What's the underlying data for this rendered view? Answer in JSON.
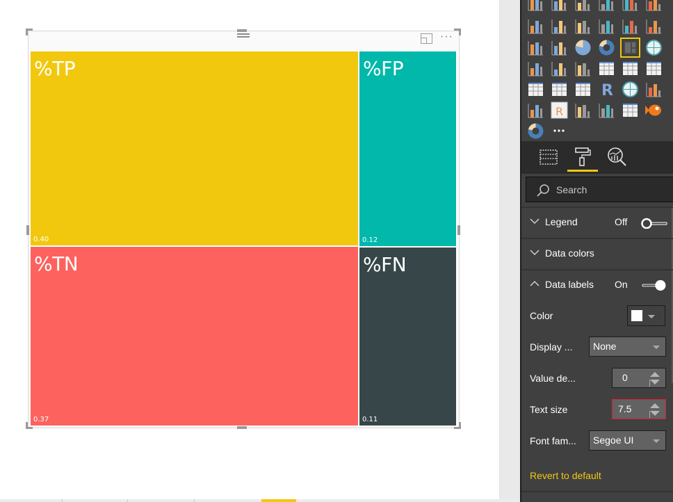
{
  "canvas": {
    "page_tabs": [
      {
        "label": ""
      },
      {
        "label": ""
      },
      {
        "label": ""
      },
      {
        "label": "",
        "active": true
      }
    ]
  },
  "visual": {
    "header_icons": [
      "drag-grip-icon",
      "focus-mode-icon",
      "more-options-icon"
    ],
    "more_options_label": "···"
  },
  "chart_data": {
    "type": "treemap",
    "title": "",
    "legend": "off",
    "data_labels": true,
    "label_color": "#ffffff",
    "tiles": [
      {
        "name": "%TP",
        "value": 0.4,
        "value_label": "0.40",
        "color": "#f2c80f"
      },
      {
        "name": "%FP",
        "value": 0.12,
        "value_label": "0.12",
        "color": "#01b8aa"
      },
      {
        "name": "%TN",
        "value": 0.37,
        "value_label": "0.37",
        "color": "#fd625e"
      },
      {
        "name": "%FN",
        "value": 0.11,
        "value_label": "0.11",
        "color": "#374649"
      }
    ]
  },
  "pane": {
    "viz_gallery": [
      "stacked-bar-icon",
      "stacked-column-icon",
      "clustered-bar-icon",
      "clustered-column-icon",
      "100-stacked-bar-icon",
      "100-stacked-column-icon",
      "line-chart-icon",
      "area-chart-icon",
      "stacked-area-icon",
      "line-clustered-column-icon",
      "line-stacked-column-icon",
      "ribbon-chart-icon",
      "waterfall-icon",
      "scatter-icon",
      "pie-icon",
      "donut-icon",
      "treemap-icon",
      "map-icon",
      "filled-map-icon",
      "funnel-icon",
      "gauge-icon",
      "card-icon",
      "multi-row-card-icon",
      "kpi-icon",
      "slicer-icon",
      "table-icon",
      "matrix-icon",
      "r-visual-icon",
      "globe-map-icon",
      "forecast-icon",
      "network-icon",
      "r-table-icon",
      "hierarchy-icon",
      "path-icon",
      "timeline-icon",
      "fish-icon",
      "chord-icon",
      "more-visuals-icon"
    ],
    "selected_viz": "treemap-icon",
    "tabs": [
      {
        "name": "fields-tab",
        "icon": "fields-icon"
      },
      {
        "name": "format-tab",
        "icon": "paint-roller-icon",
        "active": true
      },
      {
        "name": "analytics-tab",
        "icon": "analytics-icon"
      }
    ],
    "search": {
      "placeholder": "Search"
    },
    "sections": {
      "legend": {
        "title": "Legend",
        "state": "Off",
        "expanded": false
      },
      "data_colors": {
        "title": "Data colors",
        "expanded": false
      },
      "data_labels": {
        "title": "Data labels",
        "state": "On",
        "expanded": true
      }
    },
    "data_labels_props": {
      "color": {
        "label": "Color",
        "value": "#ffffff"
      },
      "display_units": {
        "label": "Display ...",
        "value": "None"
      },
      "value_decimals": {
        "label": "Value de...",
        "value": "0"
      },
      "text_size": {
        "label": "Text size",
        "value": "7.5"
      },
      "font_family": {
        "label": "Font fam...",
        "value": "Segoe UI"
      }
    },
    "revert_label": "Revert to default",
    "accent_color": "#f2c811"
  }
}
